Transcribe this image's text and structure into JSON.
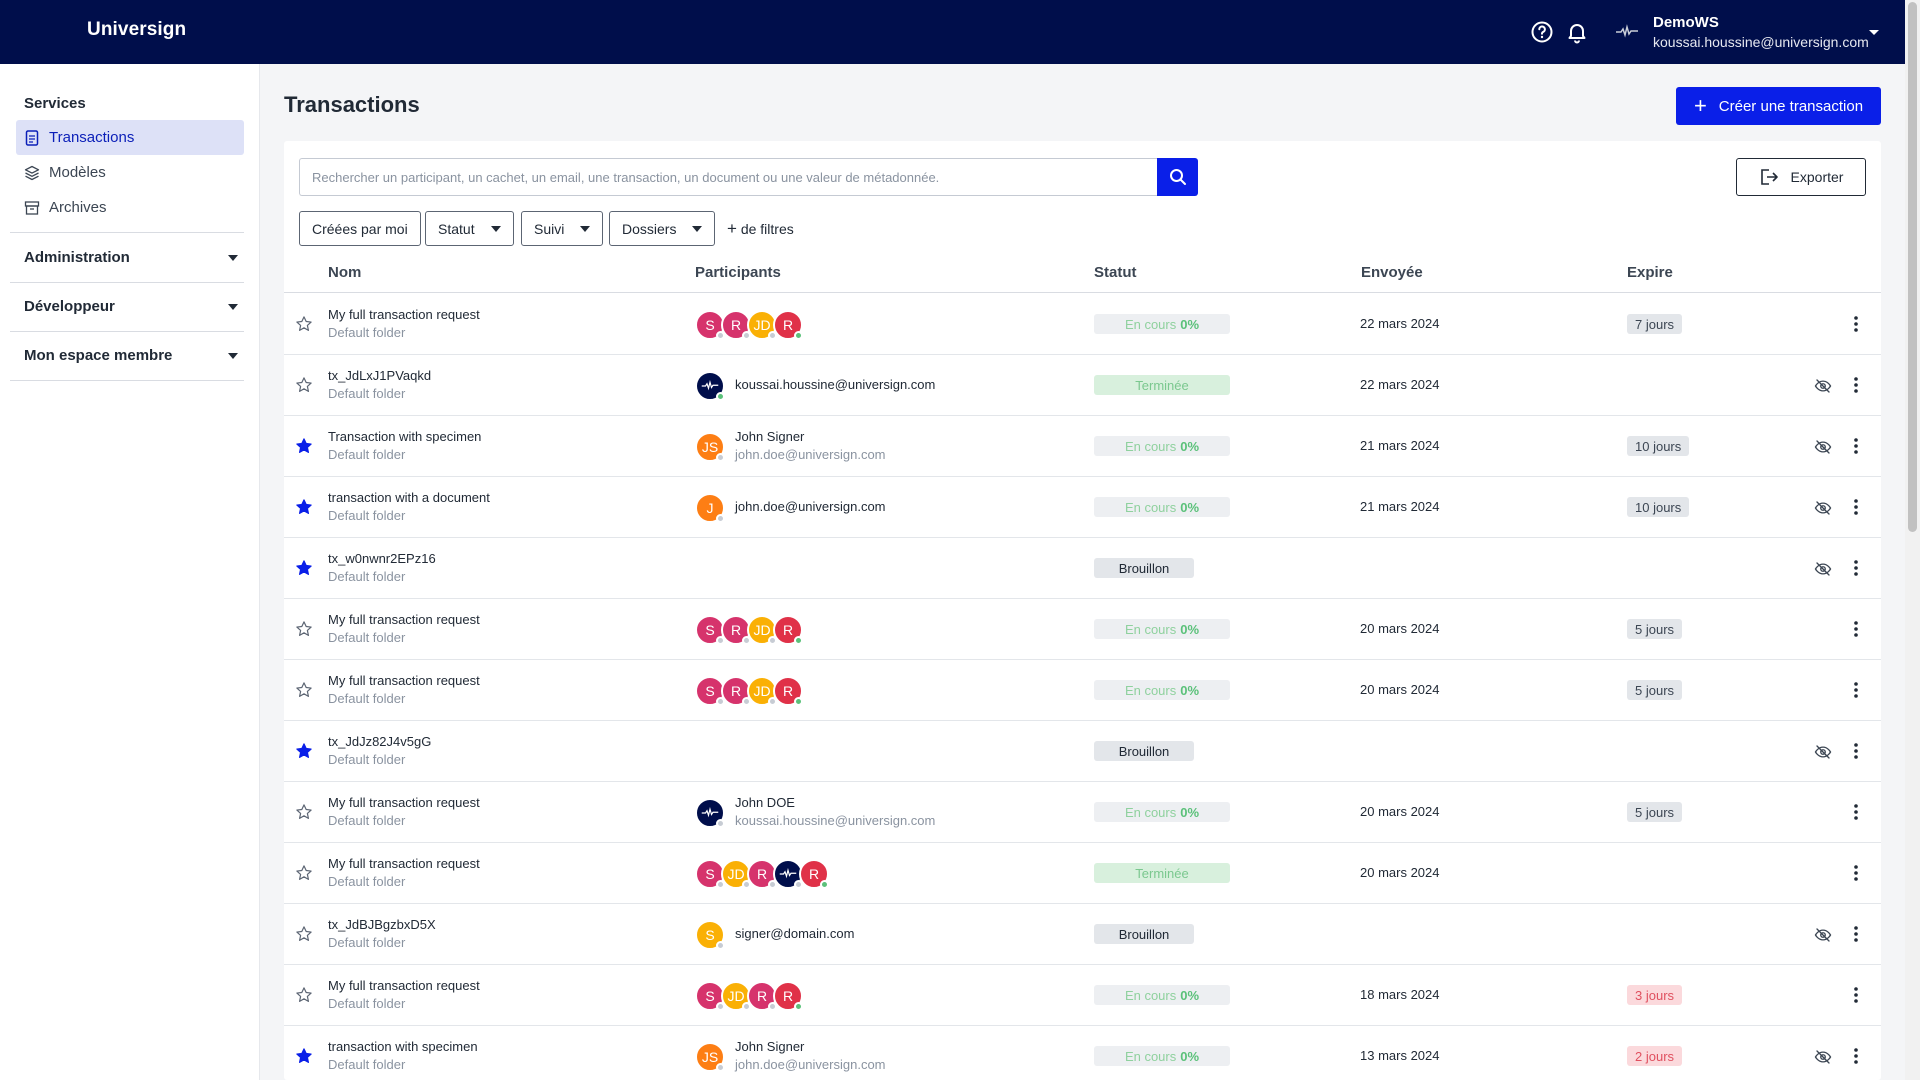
{
  "topbar": {
    "brand": "Universign",
    "workspace_name": "DemoWS",
    "workspace_email": "koussai.houssine@universign.com"
  },
  "sidebar": {
    "services_title": "Services",
    "items": [
      {
        "label": "Transactions",
        "icon": "document-icon",
        "active": true
      },
      {
        "label": "Modèles",
        "icon": "layers-icon",
        "active": false
      },
      {
        "label": "Archives",
        "icon": "archive-icon",
        "active": false
      }
    ],
    "sections": [
      {
        "label": "Administration"
      },
      {
        "label": "Développeur"
      },
      {
        "label": "Mon espace membre"
      }
    ]
  },
  "main": {
    "title": "Transactions",
    "create_label": "Créer une transaction",
    "search_placeholder": "Rechercher un participant, un cachet, un email, une transaction, un document ou une valeur de métadonnée.",
    "export_label": "Exporter",
    "filters": {
      "created_by_me": "Créées par moi",
      "status": "Statut",
      "follow": "Suivi",
      "folders": "Dossiers",
      "more": "de filtres"
    },
    "columns": {
      "name": "Nom",
      "participants": "Participants",
      "status": "Statut",
      "sent": "Envoyée",
      "expires": "Expire"
    }
  },
  "colors": {
    "navy": "#000e4b",
    "accent": "#0a1fe8",
    "pink": "#d6336c",
    "yellow": "#fab005",
    "orange": "#fd7e14",
    "red": "#e03148"
  },
  "rows": [
    {
      "name": "My full transaction request",
      "folder": "Default folder",
      "starred": false,
      "avatars": [
        {
          "t": "S",
          "c": "pink"
        },
        {
          "t": "R",
          "c": "pink"
        },
        {
          "t": "JD",
          "c": "yellow"
        },
        {
          "t": "R",
          "c": "red"
        }
      ],
      "status_kind": "progress",
      "status_text": "En cours",
      "status_pct": "0%",
      "sent": "22 mars 2024",
      "expires": "7 jours",
      "expires_warn": false,
      "hidden": false
    },
    {
      "name": "tx_JdLxJ1PVaqkd",
      "folder": "Default folder",
      "starred": false,
      "avatars": [
        {
          "t": "logo",
          "c": "navy"
        }
      ],
      "participant_name": "koussai.houssine@universign.com",
      "status_kind": "done",
      "status_text": "Terminée",
      "sent": "22 mars 2024",
      "expires": "",
      "hidden": true
    },
    {
      "name": "Transaction with specimen",
      "folder": "Default folder",
      "starred": true,
      "avatars": [
        {
          "t": "JS",
          "c": "orange"
        }
      ],
      "participant_name": "John Signer",
      "participant_email": "john.doe@universign.com",
      "status_kind": "progress",
      "status_text": "En cours",
      "status_pct": "0%",
      "sent": "21 mars 2024",
      "expires": "10 jours",
      "expires_warn": false,
      "hidden": true
    },
    {
      "name": "transaction with a document",
      "folder": "Default folder",
      "starred": true,
      "avatars": [
        {
          "t": "J",
          "c": "orange"
        }
      ],
      "participant_name": "john.doe@universign.com",
      "status_kind": "progress",
      "status_text": "En cours",
      "status_pct": "0%",
      "sent": "21 mars 2024",
      "expires": "10 jours",
      "expires_warn": false,
      "hidden": true
    },
    {
      "name": "tx_w0nwnr2EPz16",
      "folder": "Default folder",
      "starred": true,
      "avatars": [],
      "status_kind": "draft",
      "status_text": "Brouillon",
      "sent": "",
      "expires": "",
      "hidden": true
    },
    {
      "name": "My full transaction request",
      "folder": "Default folder",
      "starred": false,
      "avatars": [
        {
          "t": "S",
          "c": "pink"
        },
        {
          "t": "R",
          "c": "pink"
        },
        {
          "t": "JD",
          "c": "yellow"
        },
        {
          "t": "R",
          "c": "red"
        }
      ],
      "status_kind": "progress",
      "status_text": "En cours",
      "status_pct": "0%",
      "sent": "20 mars 2024",
      "expires": "5 jours",
      "expires_warn": false,
      "hidden": false
    },
    {
      "name": "My full transaction request",
      "folder": "Default folder",
      "starred": false,
      "avatars": [
        {
          "t": "S",
          "c": "pink"
        },
        {
          "t": "R",
          "c": "pink"
        },
        {
          "t": "JD",
          "c": "yellow"
        },
        {
          "t": "R",
          "c": "red"
        }
      ],
      "status_kind": "progress",
      "status_text": "En cours",
      "status_pct": "0%",
      "sent": "20 mars 2024",
      "expires": "5 jours",
      "expires_warn": false,
      "hidden": false
    },
    {
      "name": "tx_JdJz82J4v5gG",
      "folder": "Default folder",
      "starred": true,
      "avatars": [],
      "status_kind": "draft",
      "status_text": "Brouillon",
      "sent": "",
      "expires": "",
      "hidden": true
    },
    {
      "name": "My full transaction request",
      "folder": "Default folder",
      "starred": false,
      "avatars": [
        {
          "t": "logo",
          "c": "navy"
        }
      ],
      "participant_name": "John DOE",
      "participant_email": "koussai.houssine@universign.com",
      "status_kind": "progress",
      "status_text": "En cours",
      "status_pct": "0%",
      "sent": "20 mars 2024",
      "expires": "5 jours",
      "expires_warn": false,
      "hidden": false
    },
    {
      "name": "My full transaction request",
      "folder": "Default folder",
      "starred": false,
      "avatars": [
        {
          "t": "S",
          "c": "pink"
        },
        {
          "t": "JD",
          "c": "yellow"
        },
        {
          "t": "R",
          "c": "pink"
        },
        {
          "t": "logo",
          "c": "navy"
        },
        {
          "t": "R",
          "c": "red"
        }
      ],
      "status_kind": "done",
      "status_text": "Terminée",
      "sent": "20 mars 2024",
      "expires": "",
      "hidden": false
    },
    {
      "name": "tx_JdBJBgzbxD5X",
      "folder": "Default folder",
      "starred": false,
      "avatars": [
        {
          "t": "S",
          "c": "yellow"
        }
      ],
      "participant_name": "signer@domain.com",
      "status_kind": "draft",
      "status_text": "Brouillon",
      "sent": "",
      "expires": "",
      "hidden": true
    },
    {
      "name": "My full transaction request",
      "folder": "Default folder",
      "starred": false,
      "avatars": [
        {
          "t": "S",
          "c": "pink"
        },
        {
          "t": "JD",
          "c": "yellow"
        },
        {
          "t": "R",
          "c": "pink"
        },
        {
          "t": "R",
          "c": "red"
        }
      ],
      "status_kind": "progress",
      "status_text": "En cours",
      "status_pct": "0%",
      "sent": "18 mars 2024",
      "expires": "3 jours",
      "expires_warn": true,
      "hidden": false
    },
    {
      "name": "transaction with specimen",
      "folder": "Default folder",
      "starred": true,
      "avatars": [
        {
          "t": "JS",
          "c": "orange"
        }
      ],
      "participant_name": "John Signer",
      "participant_email": "john.doe@universign.com",
      "status_kind": "progress",
      "status_text": "En cours",
      "status_pct": "0%",
      "sent": "13 mars 2024",
      "expires": "2 jours",
      "expires_warn": true,
      "hidden": true
    }
  ]
}
